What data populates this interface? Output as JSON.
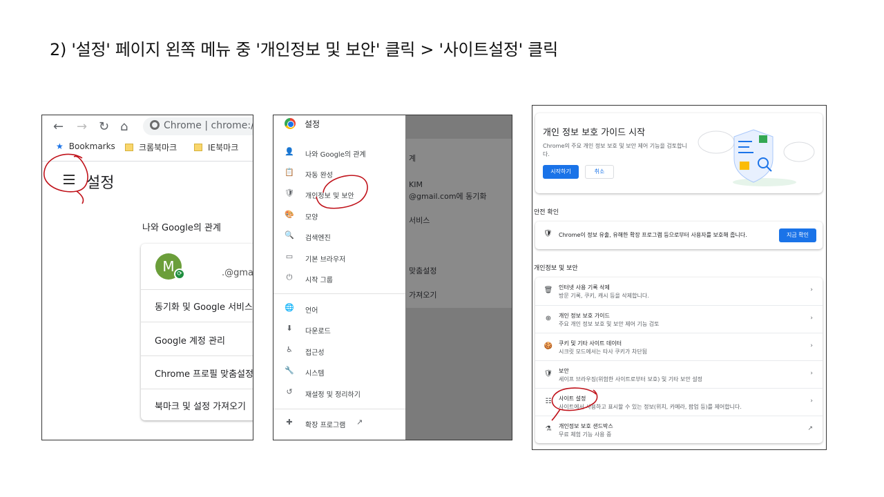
{
  "slide": {
    "title": "2) '설정' 페이지 왼쪽 메뉴 중 '개인정보 및 보안' 클릭 > '사이트설정' 클릭"
  },
  "panel1": {
    "nav": {
      "back": "←",
      "forward": "→",
      "reload": "↻",
      "home": "⌂"
    },
    "address_text": "Chrome | chrome://",
    "bookmarks": [
      "Bookmarks",
      "크롬북마크",
      "IE북마크"
    ],
    "page_title": "설정",
    "section_title": "나와 Google의 관계",
    "profile": {
      "initial": "M",
      "email": ".@gmail"
    },
    "rows": [
      "동기화 및 Google 서비스",
      "Google 계정 관리",
      "Chrome 프로필 맞춤설정",
      "북마크 및 설정 가져오기"
    ]
  },
  "panel2": {
    "title": "설정",
    "menu": [
      {
        "icon": "person-icon",
        "glyph": "👤",
        "label": "나와 Google의 관계"
      },
      {
        "icon": "clipboard-icon",
        "glyph": "📋",
        "label": "자동 완성"
      },
      {
        "icon": "shield-icon",
        "glyph": "🛡",
        "label": "개인정보 및 보안"
      },
      {
        "icon": "palette-icon",
        "glyph": "🎨",
        "label": "모양"
      },
      {
        "icon": "search-icon",
        "glyph": "🔍",
        "label": "검색엔진"
      },
      {
        "icon": "browser-icon",
        "glyph": "▭",
        "label": "기본 브라우저"
      },
      {
        "icon": "power-icon",
        "glyph": "⏻",
        "label": "시작 그룹"
      }
    ],
    "menu_advanced": [
      {
        "icon": "globe-icon",
        "glyph": "🌐",
        "label": "언어"
      },
      {
        "icon": "download-icon",
        "glyph": "⬇",
        "label": "다운로드"
      },
      {
        "icon": "accessibility-icon",
        "glyph": "♿",
        "label": "접근성"
      },
      {
        "icon": "wrench-icon",
        "glyph": "🔧",
        "label": "시스템"
      },
      {
        "icon": "history-icon",
        "glyph": "↺",
        "label": "재설정 및 정리하기"
      }
    ],
    "extensions_label": "확장 프로그램",
    "external_glyph": "↗",
    "background_texts": [
      "계",
      "KIM",
      "@gmail.com에 동기화",
      "서비스",
      "맞춤설정",
      "가져오기"
    ]
  },
  "panel3": {
    "guide": {
      "title": "개인 정보 보호 가이드 시작",
      "desc": "Chrome의 주요 개인 정보 보호 및 보안 제어 기능을 검토합니다.",
      "start": "시작하기",
      "cancel": "취소"
    },
    "safety_header": "안전 확인",
    "safety_text": "Chrome이 정보 유출, 유해한 확장 프로그램 등으로부터 사용자를 보호해 줍니다.",
    "safety_button": "지금 확인",
    "privacy_header": "개인정보 및 보안",
    "rows": [
      {
        "icon": "trash-icon",
        "glyph": "🗑",
        "title": "인터넷 사용 기록 삭제",
        "sub": "방문 기록, 쿠키, 캐시 등을 삭제합니다.",
        "end": "›"
      },
      {
        "icon": "compass-icon",
        "glyph": "⊕",
        "title": "개인 정보 보호 가이드",
        "sub": "주요 개인 정보 보호 및 보안 제어 기능 검토",
        "end": "›"
      },
      {
        "icon": "cookie-icon",
        "glyph": "🍪",
        "title": "쿠키 및 기타 사이트 데이터",
        "sub": "시크릿 모드에서는 타사 쿠키가 차단됨",
        "end": "›"
      },
      {
        "icon": "security-shield-icon",
        "glyph": "🛡",
        "title": "보안",
        "sub": "세이프 브라우징(위험한 사이트로부터 보호) 및 기타 보안 설정",
        "end": "›"
      },
      {
        "icon": "sliders-icon",
        "glyph": "☷",
        "title": "사이트 설정",
        "sub": "사이트에서 사용하고 표시할 수 있는 정보(위치, 카메라, 팝업 등)를 제어합니다.",
        "end": "›"
      },
      {
        "icon": "flask-icon",
        "glyph": "⚗",
        "title": "개인정보 보호 샌드박스",
        "sub": "무료 체험 기능 사용 중",
        "end": "↗"
      }
    ]
  }
}
